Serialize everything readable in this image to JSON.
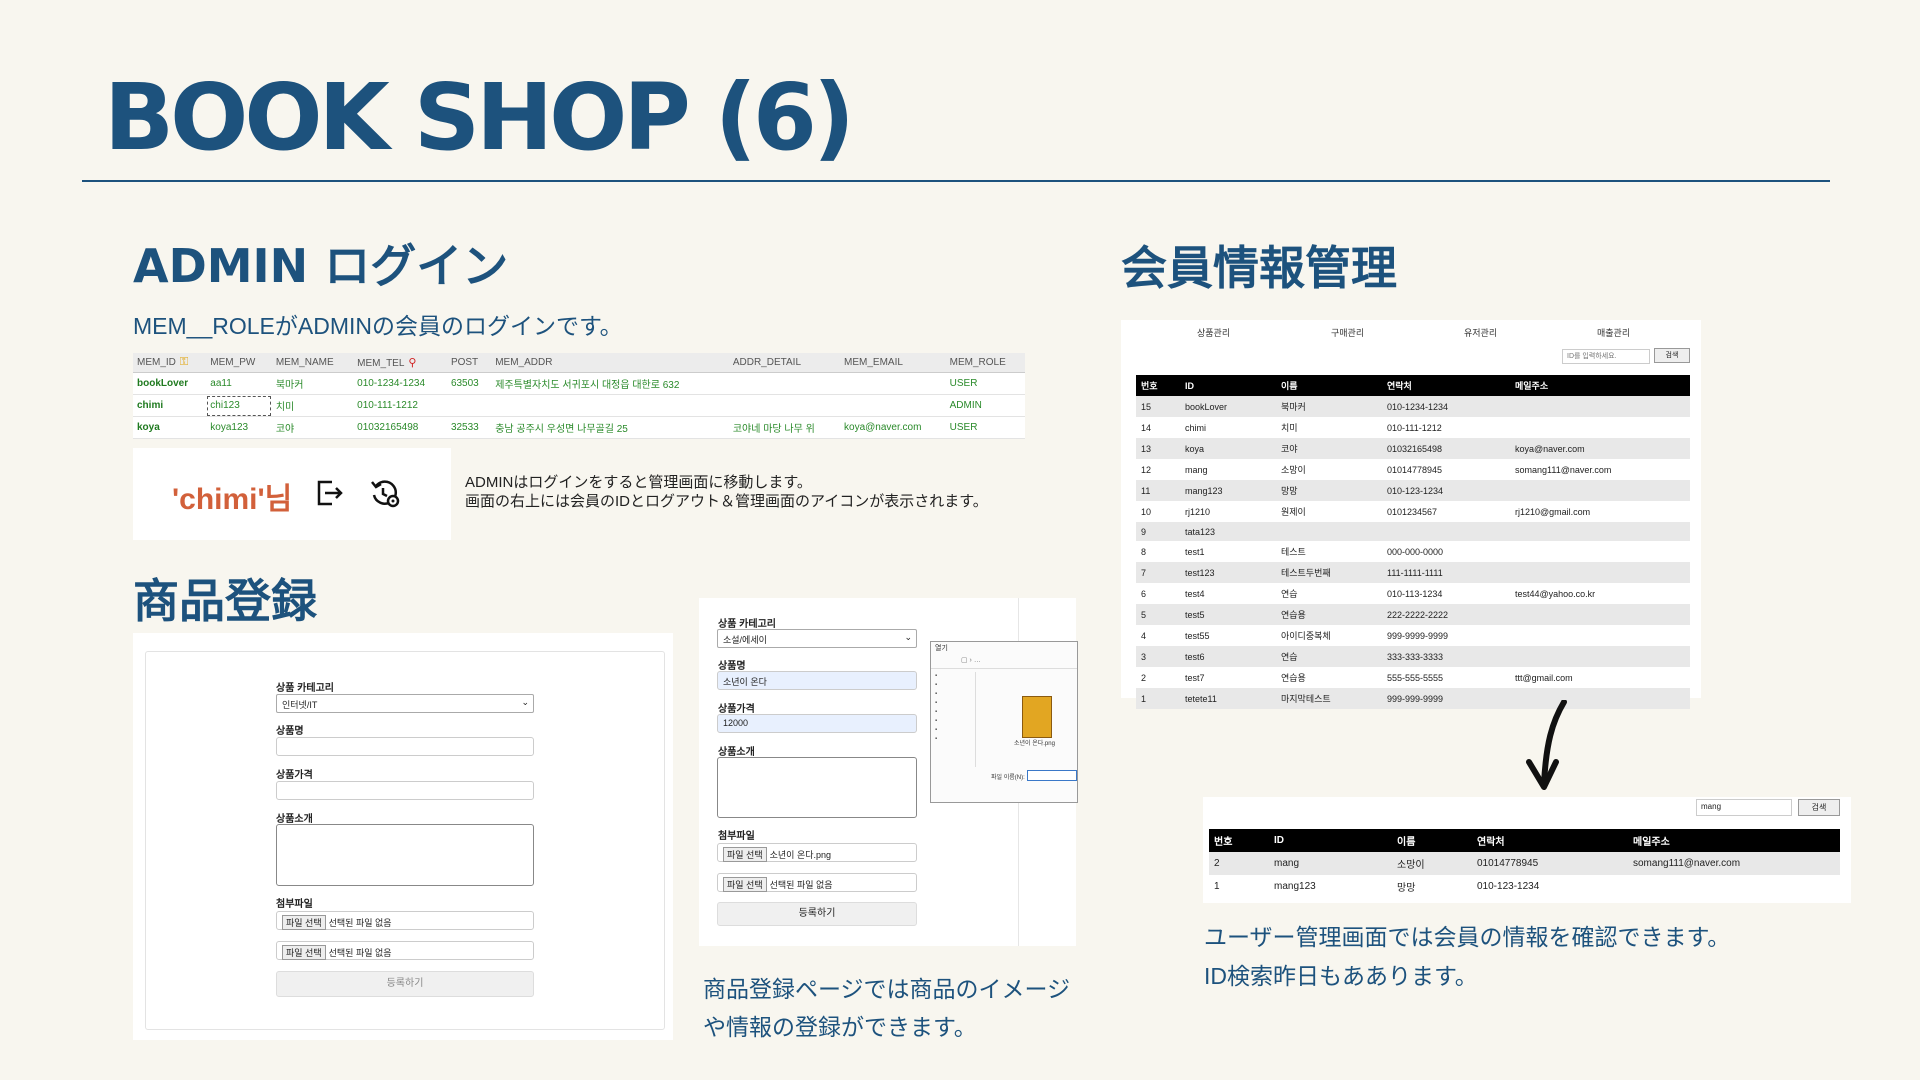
{
  "page_title": "BOOK SHOP (6)",
  "admin_login": {
    "heading": "ADMIN ログイン",
    "subtitle": "MEM__ROLEがADMINの会員のログインです。",
    "table": {
      "columns": [
        "MEM_ID",
        "MEM_PW",
        "MEM_NAME",
        "MEM_TEL",
        "POST",
        "MEM_ADDR",
        "ADDR_DETAIL",
        "MEM_EMAIL",
        "MEM_ROLE"
      ],
      "rows": [
        [
          "bookLover",
          "aa11",
          "북마커",
          "010-1234-1234",
          "63503",
          "제주특별자치도 서귀포시 대정읍 대한로 632",
          "",
          "",
          "USER"
        ],
        [
          "chimi",
          "chi123",
          "치미",
          "010-111-1212",
          "",
          "",
          "",
          "",
          "ADMIN"
        ],
        [
          "koya",
          "koya123",
          "코야",
          "01032165498",
          "32533",
          "충남 공주시 우성면 나무골길 25",
          "코야네 마당 나무 위",
          "koya@naver.com",
          "USER"
        ]
      ]
    },
    "header_user": "'chimi'님",
    "note_line1": "ADMINはログインをすると管理画面に移動します。",
    "note_line2": "画面の右上には会員のIDとログアウト＆管理画面のアイコンが表示されます。"
  },
  "product_reg": {
    "heading": "商品登録",
    "form1": {
      "category_label": "상품 카테고리",
      "category_value": "인터넷/IT",
      "name_label": "상품명",
      "price_label": "상품가격",
      "intro_label": "상품소개",
      "file_label": "첨부파일",
      "file_button": "파일 선택",
      "file_none": "선택된 파일 없음",
      "submit": "등록하기"
    },
    "form2": {
      "category_label": "상품 카테고리",
      "category_value": "소설/에세이",
      "name_label": "상품명",
      "name_value": "소년이 온다",
      "price_label": "상품가격",
      "price_value": "12000",
      "intro_label": "상품소개",
      "file_label": "첨부파일",
      "file_button": "파일 선택",
      "file1": "소년이 온다.png",
      "file2": "선택된 파일 없음",
      "submit": "등록하기"
    },
    "dialog": {
      "title": "열기",
      "thumb_label": "소년이 온다.png",
      "filename_label": "파일 이름(N):"
    },
    "caption_line1": "商品登録ページでは商品のイメージ",
    "caption_line2": "や情報の登録ができます。"
  },
  "member_mgmt": {
    "heading": "会員情報管理",
    "nav": [
      "상품관리",
      "구매관리",
      "유저관리",
      "매출관리"
    ],
    "search_placeholder": "ID를 입력하세요.",
    "search_button": "검색",
    "columns": [
      "번호",
      "ID",
      "이름",
      "연락처",
      "메일주소"
    ],
    "rows": [
      [
        "15",
        "bookLover",
        "북마커",
        "010-1234-1234",
        ""
      ],
      [
        "14",
        "chimi",
        "치미",
        "010-111-1212",
        ""
      ],
      [
        "13",
        "koya",
        "코야",
        "01032165498",
        "koya@naver.com"
      ],
      [
        "12",
        "mang",
        "소망이",
        "01014778945",
        "somang111@naver.com"
      ],
      [
        "11",
        "mang123",
        "망망",
        "010-123-1234",
        ""
      ],
      [
        "10",
        "rj1210",
        "원제이",
        "0101234567",
        "rj1210@gmail.com"
      ],
      [
        "9",
        "tata123",
        "",
        "",
        ""
      ],
      [
        "8",
        "test1",
        "테스트",
        "000-000-0000",
        ""
      ],
      [
        "7",
        "test123",
        "테스트두번째",
        "111-1111-1111",
        ""
      ],
      [
        "6",
        "test4",
        "연습",
        "010-113-1234",
        "test44@yahoo.co.kr"
      ],
      [
        "5",
        "test5",
        "연습용",
        "222-2222-2222",
        ""
      ],
      [
        "4",
        "test55",
        "아이디중복체",
        "999-9999-9999",
        ""
      ],
      [
        "3",
        "test6",
        "연습",
        "333-333-3333",
        ""
      ],
      [
        "2",
        "test7",
        "연습용",
        "555-555-5555",
        "ttt@gmail.com"
      ],
      [
        "1",
        "tetete11",
        "마지막테스트",
        "999-999-9999",
        ""
      ]
    ],
    "search_result": {
      "query": "mang",
      "button": "검색",
      "rows": [
        [
          "2",
          "mang",
          "소망이",
          "01014778945",
          "somang111@naver.com"
        ],
        [
          "1",
          "mang123",
          "망망",
          "010-123-1234",
          ""
        ]
      ]
    },
    "caption_line1": "ユーザー管理画面では会員の情報を確認できます。",
    "caption_line2": "ID検索昨日もああります。"
  }
}
